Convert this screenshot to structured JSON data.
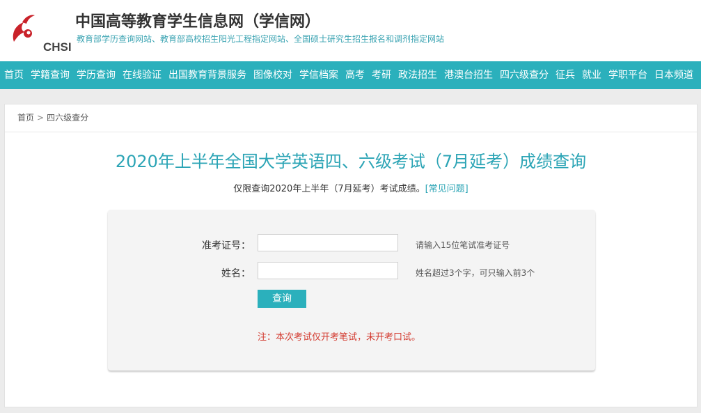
{
  "header": {
    "logo_text": "CHSI",
    "title": "中国高等教育学生信息网（学信网）",
    "subtitle": "教育部学历查询网站、教育部高校招生阳光工程指定网站、全国硕士研究生招生报名和调剂指定网站"
  },
  "nav": {
    "items": [
      "首页",
      "学籍查询",
      "学历查询",
      "在线验证",
      "出国教育背景服务",
      "图像校对",
      "学信档案",
      "高考",
      "考研",
      "政法招生",
      "港澳台招生",
      "四六级查分",
      "征兵",
      "就业",
      "学职平台",
      "日本频道"
    ]
  },
  "breadcrumb": {
    "home": "首页",
    "separator": ">",
    "current": "四六级查分"
  },
  "main": {
    "title": "2020年上半年全国大学英语四、六级考试（7月延考）成绩查询",
    "note_text": "仅限查询2020年上半年（7月延考）考试成绩。",
    "faq_link": "[常见问题]"
  },
  "form": {
    "exam_id_label": "准考证号：",
    "exam_id_value": "",
    "exam_id_hint": "请输入15位笔试准考证号",
    "name_label": "姓名：",
    "name_value": "",
    "name_hint": "姓名超过3个字，可只输入前3个",
    "submit_label": "查询",
    "warning": "注：本次考试仅开考笔试，未开考口试。"
  },
  "colors": {
    "accent": "#2bb0bc",
    "title": "#2ba4b5",
    "warning": "#d33a2f"
  }
}
